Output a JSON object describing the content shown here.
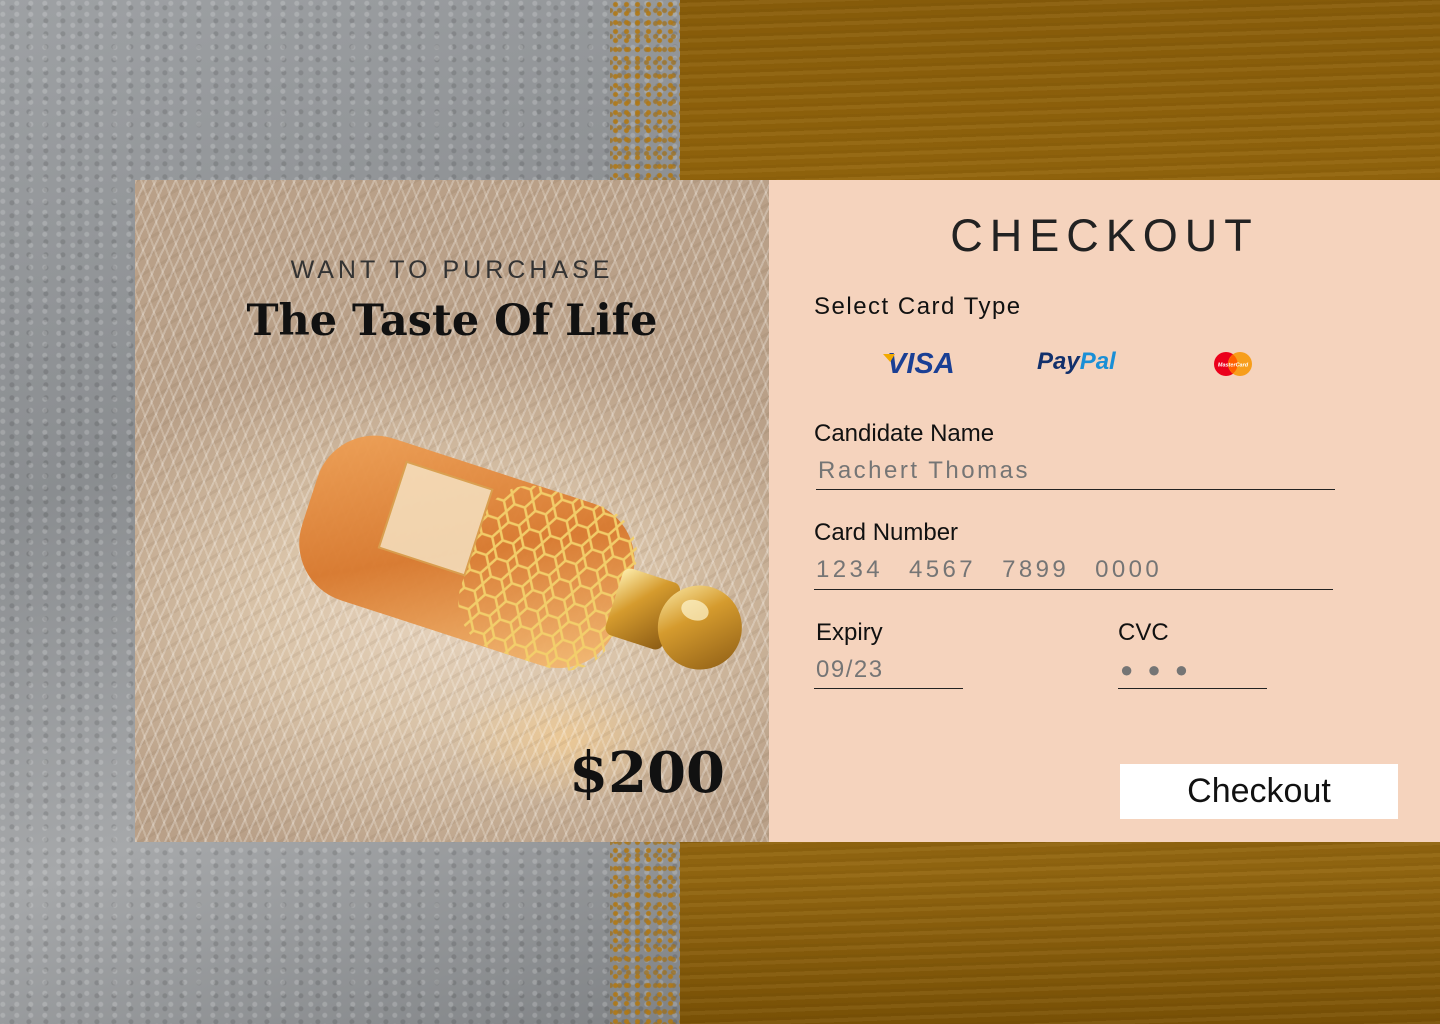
{
  "product": {
    "eyebrow": "WANT TO PURCHASE",
    "title": "The Taste Of Life",
    "price": "$200",
    "image": "perfume-bottle-on-fur"
  },
  "checkout": {
    "title": "CHECKOUT",
    "select_card_label": "Select Card Type",
    "card_types": {
      "visa": "VISA",
      "paypal_pay": "Pay",
      "paypal_pal": "Pal",
      "mastercard_text": "MasterCard"
    },
    "fields": {
      "name_label": "Candidate Name",
      "name_placeholder": "Rachert Thomas",
      "number_label": "Card Number",
      "number_placeholder": "1234 4567 7899 0000",
      "expiry_label": "Expiry",
      "expiry_placeholder": "09/23",
      "cvc_label": "CVC",
      "cvc_placeholder": "● ● ●"
    },
    "button_label": "Checkout"
  },
  "colors": {
    "panel_bg": "#f5d3bd",
    "visa_blue": "#1a3f94",
    "paypal_dark": "#12306b",
    "paypal_light": "#1a8fd6",
    "mastercard_red": "#eb001b",
    "mastercard_orange": "#f79e1b"
  }
}
